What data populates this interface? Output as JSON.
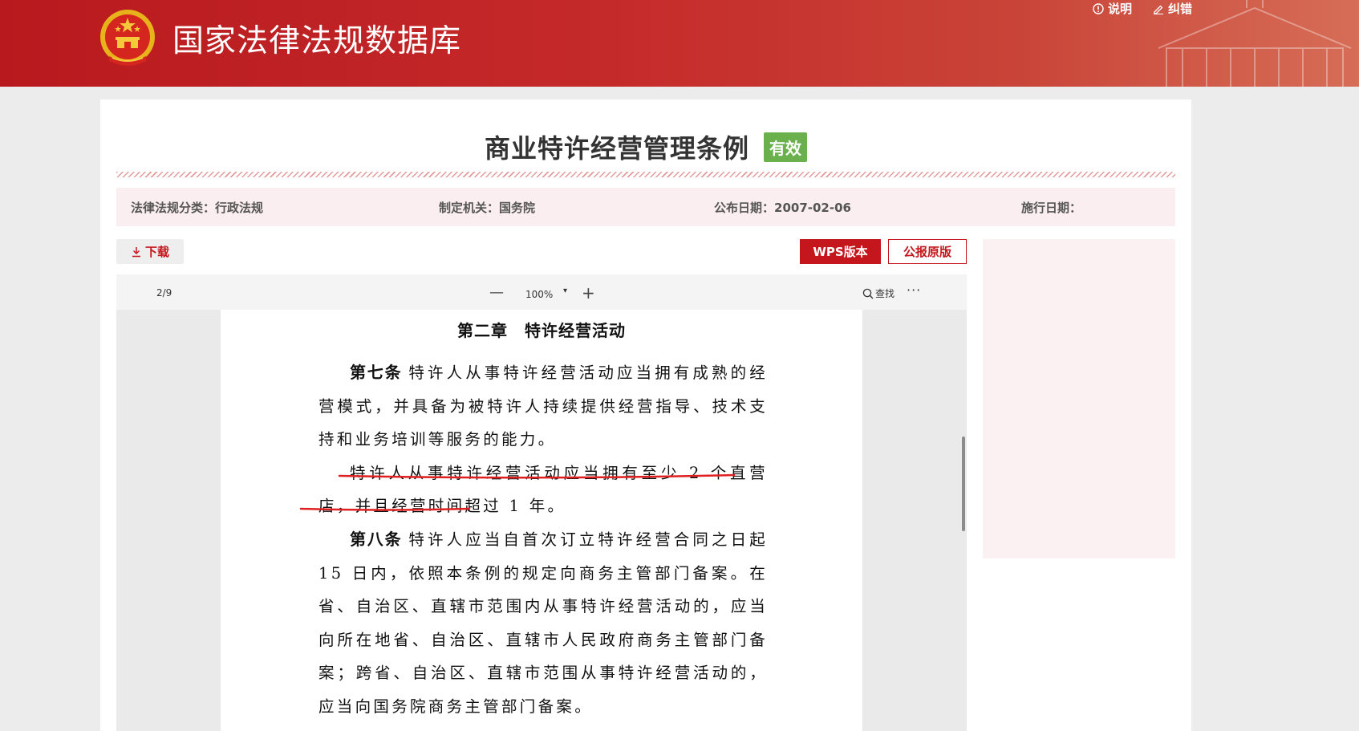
{
  "header": {
    "site_title": "国家法律法规数据库",
    "links": [
      {
        "icon": "info-icon",
        "label": "说明"
      },
      {
        "icon": "pencil-icon",
        "label": "纠错"
      }
    ],
    "colors": {
      "primary": "#c4161c",
      "accent_green": "#6ab04c",
      "meta_bg": "#fbeef0"
    }
  },
  "document": {
    "title": "商业特许经营管理条例",
    "status": "有效",
    "meta": {
      "category_label": "法律法规分类：",
      "category_value": "行政法规",
      "authority_label": "制定机关：",
      "authority_value": "国务院",
      "publish_label": "公布日期：",
      "publish_value": "2007-02-06",
      "effective_label": "施行日期："
    }
  },
  "actions": {
    "download": "下载",
    "wps": "WPS版本",
    "gazette": "公报原版"
  },
  "viewer": {
    "page_counter": "2/9",
    "zoom_out": "—",
    "zoom": "100%",
    "zoom_in": "+",
    "find": "查找",
    "more": "···",
    "content": {
      "chapter": "第二章　特许经营活动",
      "article7_no": "第七条",
      "article7_text": "特许人从事特许经营活动应当拥有成熟的经营模式，并具备为被特许人持续提供经营指导、技术支持和业务培训等服务的能力。",
      "article7_p2": "特许人从事特许经营活动应当拥有至少 2 个直营店，并且经营时间超过 1 年。",
      "article8_no": "第八条",
      "article8_text": "特许人应当自首次订立特许经营合同之日起 15 日内，依照本条例的规定向商务主管部门备案。在省、自治区、直辖市范围内从事特许经营活动的，应当向所在地省、自治区、直辖市人民政府商务主管部门备案；跨省、自治区、直辖市范围从事特许经营活动的，应当向国务院商务主管部门备案。"
    }
  }
}
